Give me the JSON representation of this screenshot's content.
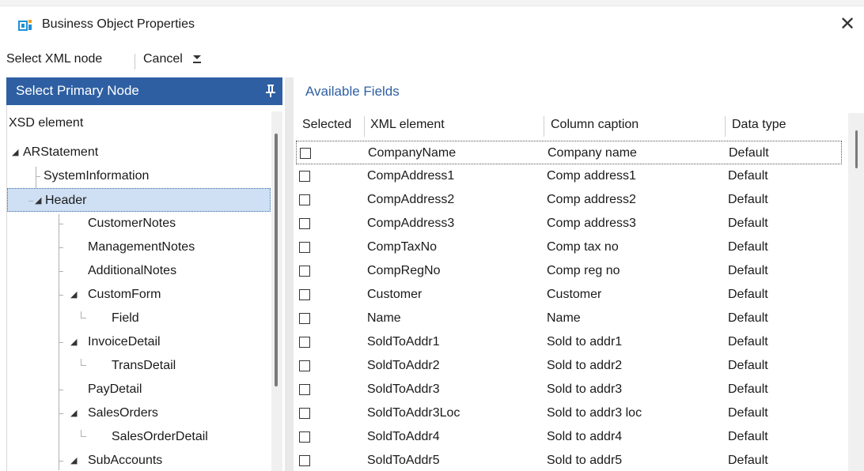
{
  "window": {
    "title": "Business Object Properties",
    "close_glyph": "✕"
  },
  "toolbar": {
    "select_xml_node": "Select XML node",
    "cancel": "Cancel"
  },
  "left_panel": {
    "header": "Select Primary Node",
    "column_header": "XSD element",
    "tree": [
      {
        "label": "ARStatement",
        "expandable": true
      },
      {
        "label": "SystemInformation",
        "expandable": false
      },
      {
        "label": "Header",
        "expandable": true,
        "selected": true
      },
      {
        "label": "CustomerNotes",
        "expandable": false
      },
      {
        "label": "ManagementNotes",
        "expandable": false
      },
      {
        "label": "AdditionalNotes",
        "expandable": false
      },
      {
        "label": "CustomForm",
        "expandable": true
      },
      {
        "label": "Field",
        "expandable": false
      },
      {
        "label": "InvoiceDetail",
        "expandable": true
      },
      {
        "label": "TransDetail",
        "expandable": false
      },
      {
        "label": "PayDetail",
        "expandable": false
      },
      {
        "label": "SalesOrders",
        "expandable": true
      },
      {
        "label": "SalesOrderDetail",
        "expandable": false
      },
      {
        "label": "SubAccounts",
        "expandable": true
      }
    ]
  },
  "right_panel": {
    "title": "Available Fields",
    "columns": [
      "Selected",
      "XML element",
      "Column caption",
      "Data type"
    ],
    "rows": [
      {
        "selected": false,
        "xml_element": "CompanyName",
        "caption": "Company name",
        "data_type": "Default"
      },
      {
        "selected": false,
        "xml_element": "CompAddress1",
        "caption": "Comp address1",
        "data_type": "Default"
      },
      {
        "selected": false,
        "xml_element": "CompAddress2",
        "caption": "Comp address2",
        "data_type": "Default"
      },
      {
        "selected": false,
        "xml_element": "CompAddress3",
        "caption": "Comp address3",
        "data_type": "Default"
      },
      {
        "selected": false,
        "xml_element": "CompTaxNo",
        "caption": "Comp tax no",
        "data_type": "Default"
      },
      {
        "selected": false,
        "xml_element": "CompRegNo",
        "caption": "Comp reg no",
        "data_type": "Default"
      },
      {
        "selected": false,
        "xml_element": "Customer",
        "caption": "Customer",
        "data_type": "Default"
      },
      {
        "selected": false,
        "xml_element": "Name",
        "caption": "Name",
        "data_type": "Default"
      },
      {
        "selected": false,
        "xml_element": "SoldToAddr1",
        "caption": "Sold to addr1",
        "data_type": "Default"
      },
      {
        "selected": false,
        "xml_element": "SoldToAddr2",
        "caption": "Sold to addr2",
        "data_type": "Default"
      },
      {
        "selected": false,
        "xml_element": "SoldToAddr3",
        "caption": "Sold to addr3",
        "data_type": "Default"
      },
      {
        "selected": false,
        "xml_element": "SoldToAddr3Loc",
        "caption": "Sold to addr3 loc",
        "data_type": "Default"
      },
      {
        "selected": false,
        "xml_element": "SoldToAddr4",
        "caption": "Sold to addr4",
        "data_type": "Default"
      },
      {
        "selected": false,
        "xml_element": "SoldToAddr5",
        "caption": "Sold to addr5",
        "data_type": "Default"
      }
    ]
  },
  "colors": {
    "accent": "#2e5fa3",
    "selection": "#cfe0f4"
  },
  "icons": {
    "app": "business-object-icon",
    "pin": "pin-icon",
    "close": "close-icon",
    "expand": "expanded-arrow-icon"
  }
}
